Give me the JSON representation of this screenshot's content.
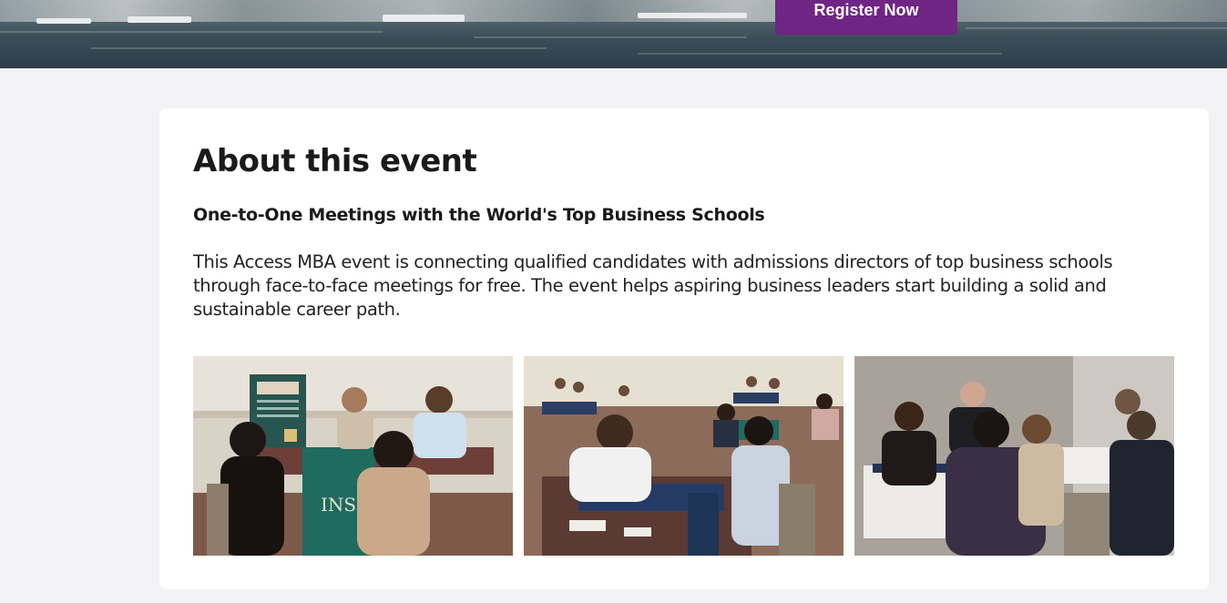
{
  "hero": {
    "register_label": "Register Now",
    "accent_color": "#6f2583"
  },
  "about": {
    "title": "About this event",
    "subtitle": "One-to-One Meetings with the World's Top Business Schools",
    "description": "This Access MBA event is connecting qualified candidates with admissions directors of top business schools through face-to-face meetings for free. The event helps aspiring business leaders start building a solid and sustainable career path."
  },
  "gallery": {
    "photos": [
      {
        "name": "event-photo-1",
        "banner_text": "INSE"
      },
      {
        "name": "event-photo-2"
      },
      {
        "name": "event-photo-3"
      }
    ]
  }
}
